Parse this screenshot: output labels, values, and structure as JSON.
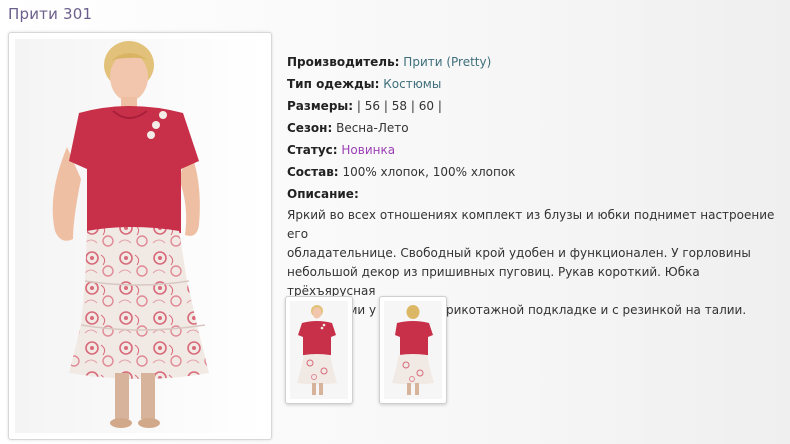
{
  "product": {
    "title": "Прити 301"
  },
  "details": {
    "manufacturer": {
      "label": "Производитель:",
      "value": "Прити (Pretty)"
    },
    "type": {
      "label": "Тип одежды:",
      "value": "Костюмы"
    },
    "sizes": {
      "label": "Размеры:",
      "prefix": "|",
      "items": [
        "56",
        "58",
        "60"
      ]
    },
    "season": {
      "label": "Сезон:",
      "value": "Весна-Лето"
    },
    "status": {
      "label": "Статус:",
      "value": "Новинка"
    },
    "composition": {
      "label": "Состав:",
      "value": "100% хлопок, 100% хлопок"
    },
    "description": {
      "label": "Описание:",
      "lines": [
        "Яркий во всех отношениях комплект из блузы и юбки поднимет настроение его",
        "обладательнице. Свободный крой удобен и функционален. У горловины",
        "небольшой декор из пришивных пуговиц. Рукав короткий. Юбка трёхъярусная",
        "со сборками у швов, на трикотажной подкладке и с резинкой на талии."
      ]
    }
  },
  "gallery": {
    "main_image": "model-front-photo",
    "thumbnails": [
      "model-front-thumb",
      "model-back-thumb"
    ]
  },
  "colors": {
    "title": "#6b5f8c",
    "link": "#3d6e7a",
    "status": "#9b3fb5",
    "blouse": "#c8304a",
    "skirt_base": "#f1e9e4",
    "skirt_print": "#d86a7a"
  }
}
